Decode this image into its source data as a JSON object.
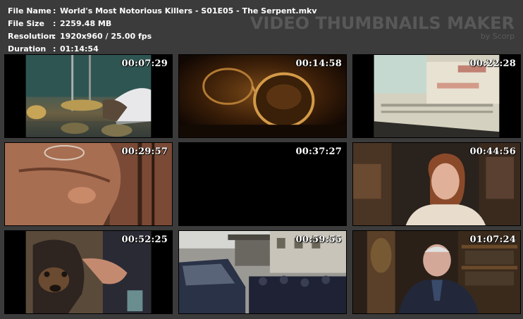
{
  "info": {
    "rows": [
      {
        "label": "File Name",
        "value": "World's Most Notorious Killers - S01E05 - The Serpent.mkv"
      },
      {
        "label": "File Size",
        "value": "2259.48 MB"
      },
      {
        "label": "Resolution",
        "value": "1920x960 / 25.00 fps"
      },
      {
        "label": "Duration",
        "value": "01:14:54"
      }
    ],
    "separator": ":"
  },
  "brand": {
    "title": "VIDEO THUMBNAILS MAKER",
    "subtitle": "by Scorp"
  },
  "thumbnails": [
    {
      "timestamp": "00:07:29"
    },
    {
      "timestamp": "00:14:58"
    },
    {
      "timestamp": "00:22:28"
    },
    {
      "timestamp": "00:29:57"
    },
    {
      "timestamp": "00:37:27"
    },
    {
      "timestamp": "00:44:56"
    },
    {
      "timestamp": "00:52:25"
    },
    {
      "timestamp": "00:59:55"
    },
    {
      "timestamp": "01:07:24"
    }
  ]
}
